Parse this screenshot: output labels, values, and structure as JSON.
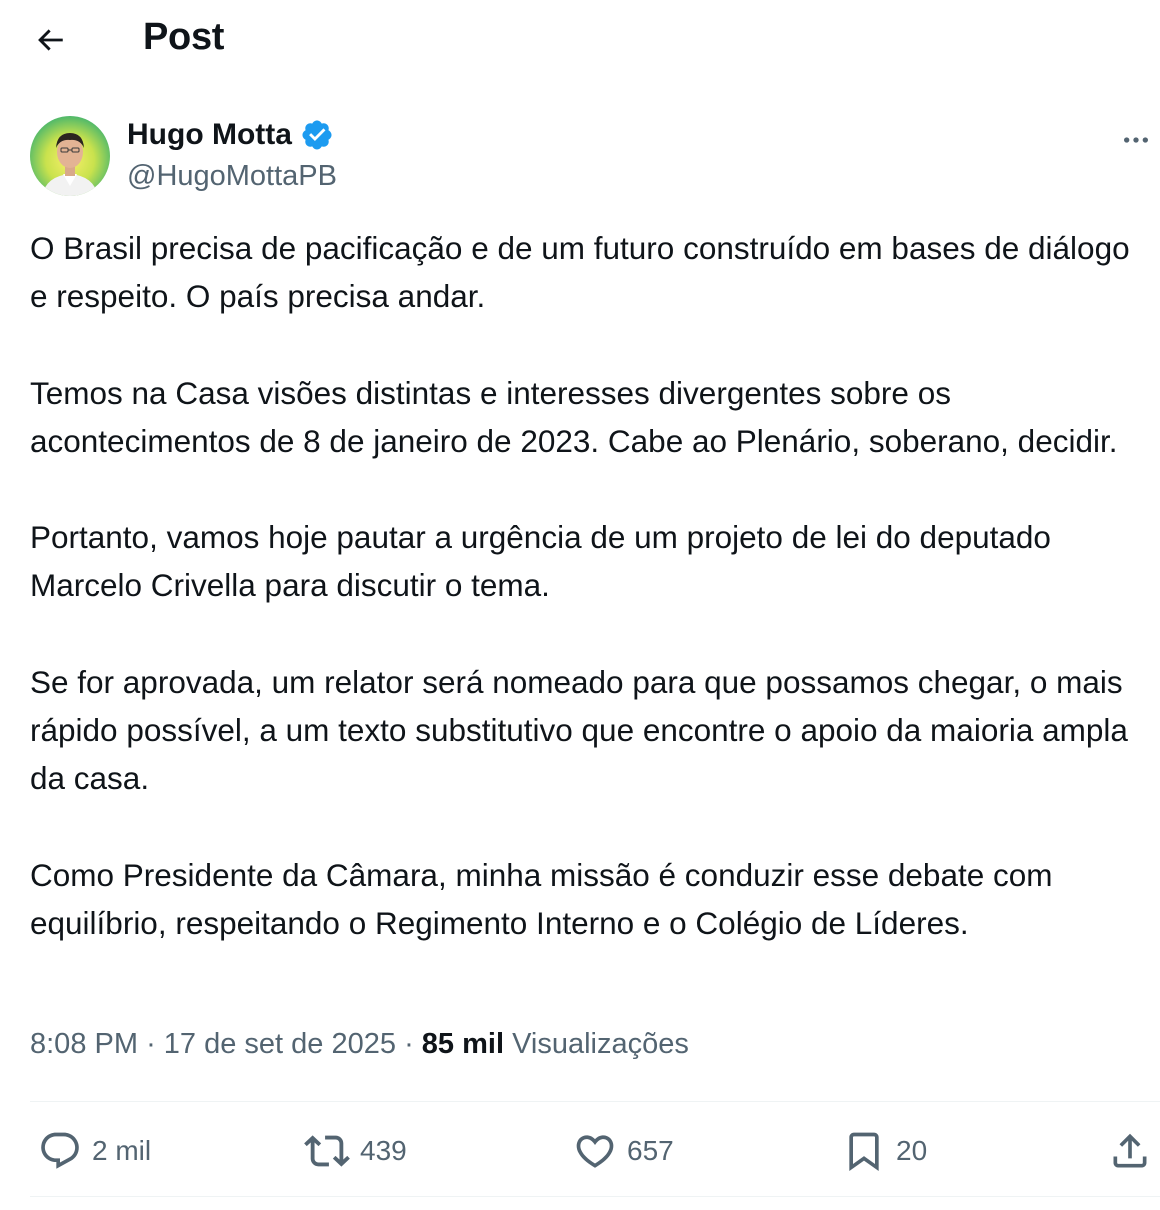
{
  "header": {
    "back_icon": "arrow-left-icon",
    "title": "Post"
  },
  "author": {
    "display_name": "Hugo Motta",
    "handle": "@HugoMottaPB",
    "verified_icon": "verified-badge-icon",
    "more_icon": "more-horizontal-icon",
    "avatar": "profile-photo"
  },
  "post": {
    "paragraphs": [
      "O Brasil precisa de pacificação e de um futuro construído em bases de diálogo e respeito. O país precisa andar.",
      "Temos na Casa visões distintas e interesses divergentes sobre os acontecimentos de 8 de janeiro de 2023. Cabe ao Plenário, soberano, decidir.",
      "Portanto, vamos hoje pautar a urgência de um projeto de lei do deputado Marcelo Crivella para discutir o tema.",
      "Se for aprovada, um relator será nomeado para que possamos chegar, o mais rápido possível, a um texto substitutivo que encontre o apoio da maioria ampla da casa.",
      "Como Presidente da Câmara, minha missão é conduzir esse debate com equilíbrio, respeitando o Regimento Interno e o Colégio de Líderes."
    ],
    "time": "8:08 PM",
    "date": "17 de set de 2025",
    "separator": "·",
    "views_count": "85 mil",
    "views_label": "Visualizações"
  },
  "actions": {
    "reply": {
      "icon": "reply-icon",
      "count": "2 mil"
    },
    "repost": {
      "icon": "repost-icon",
      "count": "439"
    },
    "like": {
      "icon": "heart-icon",
      "count": "657"
    },
    "bookmark": {
      "icon": "bookmark-icon",
      "count": "20"
    },
    "share": {
      "icon": "share-icon"
    }
  },
  "colors": {
    "text": "#0f1419",
    "secondary": "#536471",
    "verified": "#1d9bf0",
    "divider": "#eff3f4"
  }
}
